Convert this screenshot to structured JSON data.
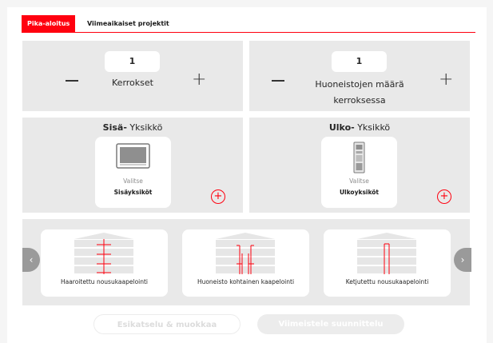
{
  "tabs": [
    {
      "label": "Pika-aloitus",
      "active": true
    },
    {
      "label": "Viimeaikaiset projektit",
      "active": false
    }
  ],
  "floors": {
    "value": "1",
    "label": "Kerrokset"
  },
  "apartments": {
    "value": "1",
    "label_line1": "Huoneistojen määrä",
    "label_line2": "kerroksessa"
  },
  "indoor": {
    "title_bold": "Sisä-",
    "title_rest": " Yksikkö",
    "select": "Valitse",
    "name": "Sisäyksiköt"
  },
  "outdoor": {
    "title_bold": "Ulko-",
    "title_rest": " Yksikkö",
    "select": "Valitse",
    "name": "Ulkoyksiköt"
  },
  "plus_symbol": "+",
  "minus_symbol": "−",
  "add_symbol": "+",
  "nav_left_symbol": "‹",
  "nav_right_symbol": "›",
  "wiring_options": [
    {
      "label": "Haaroitettu nousukaapelointi"
    },
    {
      "label": "Huoneisto kohtainen kaapelointi"
    },
    {
      "label": "Ketjutettu nousukaapelointi"
    }
  ],
  "buttons": {
    "preview": "Esikatselu & muokkaa",
    "finish": "Viimeistele suunnittelu"
  },
  "colors": {
    "accent": "#ff000f",
    "panel": "#e9e9e9",
    "nav": "#9a9a9a"
  }
}
